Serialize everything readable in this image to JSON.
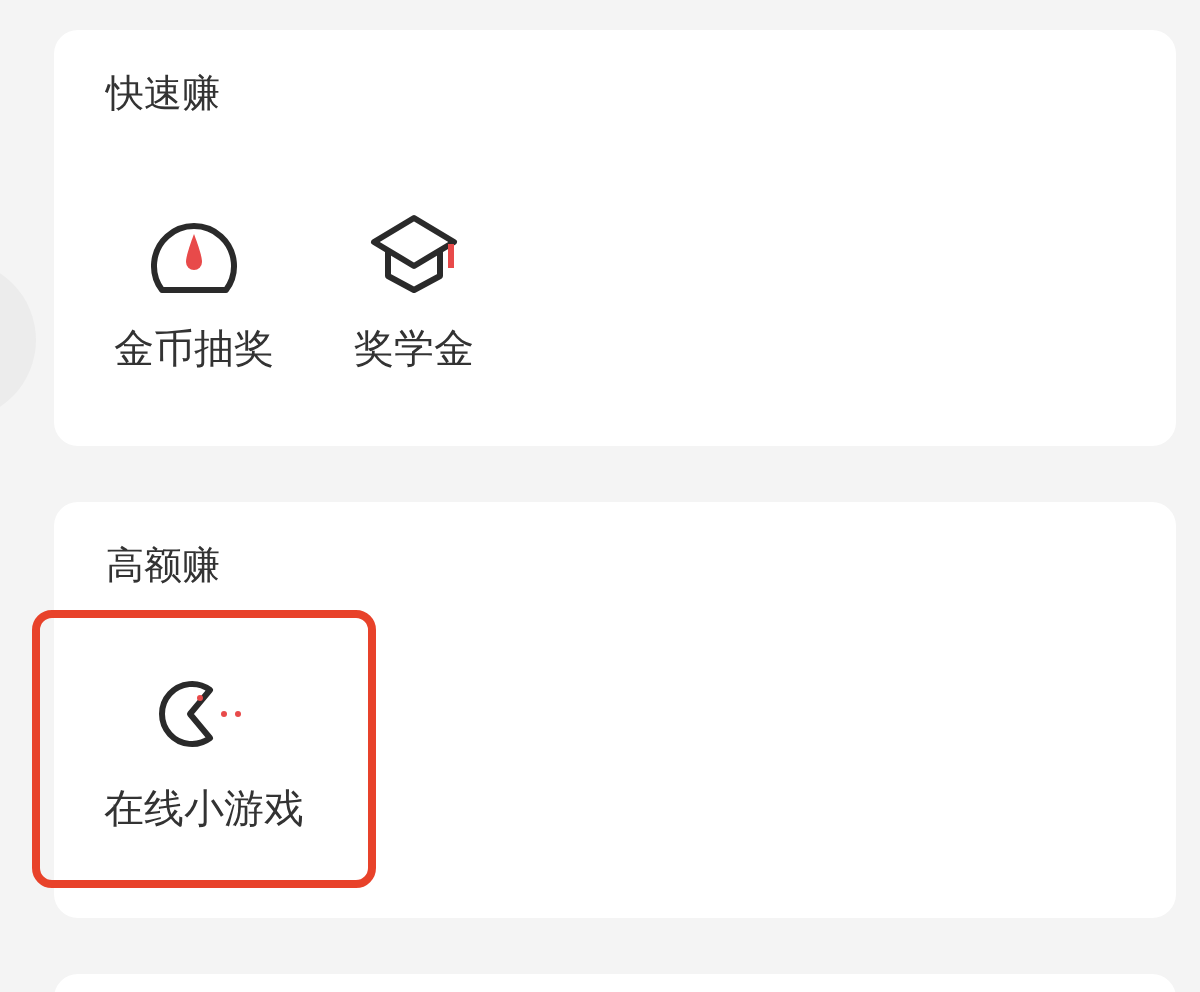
{
  "sections": [
    {
      "title": "快速赚",
      "items": [
        {
          "label": "金币抽奖",
          "kind": "gauge",
          "highlighted": false
        },
        {
          "label": "奖学金",
          "kind": "cap",
          "highlighted": false
        }
      ]
    },
    {
      "title": "高额赚",
      "items": [
        {
          "label": "在线小游戏",
          "kind": "pacman",
          "highlighted": true
        }
      ]
    }
  ]
}
